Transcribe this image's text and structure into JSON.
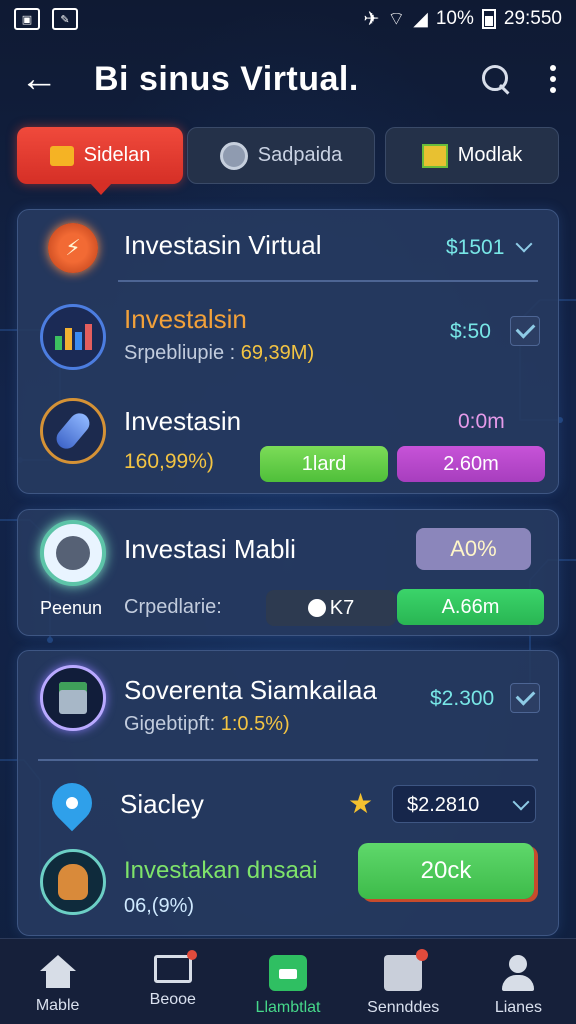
{
  "status_bar": {
    "battery": "10%",
    "time": "29:550"
  },
  "header": {
    "title": "Bi sinus Virtual."
  },
  "tabs": [
    {
      "label": "Sidelan"
    },
    {
      "label": "Sadpaida"
    },
    {
      "label": "Modlak"
    }
  ],
  "card1": {
    "header": {
      "title": "Investasin Virtual",
      "value": "$1501"
    },
    "item1": {
      "title": "Investalsin",
      "subtitle_label": "Srpebliupie :",
      "subtitle_value": "69,39M)",
      "value": "$:50"
    },
    "item2": {
      "title": "Investasin",
      "percent": "160,99%)",
      "value": "0:0m",
      "btn1": "1lard",
      "btn2": "2.60m"
    }
  },
  "card2": {
    "title": "Investasi Mabli",
    "badge": "A0%",
    "icon_caption": "Peenun",
    "subtitle": "Crpedlarie:",
    "toggle_value": "K7",
    "btn": "A.66m"
  },
  "card3": {
    "item1": {
      "title": "Soverenta Siamkailaa",
      "subtitle_label": "Gigebtipft:",
      "subtitle_value": "1:0.5%)",
      "value": "$2.300"
    },
    "item2": {
      "title": "Siacley",
      "select_value": "$2.2810"
    },
    "item3": {
      "title": "Investakan dnsaai",
      "percent": "06,(9%)",
      "btn": "20ck"
    }
  },
  "bottom_nav": [
    {
      "label": "Mable"
    },
    {
      "label": "Beooe"
    },
    {
      "label": "Llambtlat"
    },
    {
      "label": "Sennddes"
    },
    {
      "label": "Lianes"
    }
  ],
  "colors": {
    "accent_red": "#e23b2e",
    "accent_green": "#46d88a",
    "card_bg": "#263a5f"
  }
}
